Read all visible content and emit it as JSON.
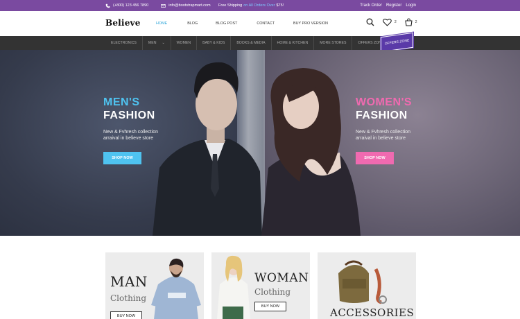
{
  "topbar": {
    "phone": "(+800) 123 456 7890",
    "email": "info@bootstrapmart.com",
    "shipping_prefix": "Free Shipping",
    "shipping_highlight": "on All Orders Over",
    "shipping_amount": "$75!",
    "links": [
      "Track Order",
      "Register",
      "Login"
    ]
  },
  "header": {
    "logo": "Believe",
    "nav": [
      "HOME",
      "BLOG",
      "BLOG POST",
      "CONTACT",
      "BUY PRO VERSION"
    ],
    "wishlist_count": "2",
    "cart_count": "2"
  },
  "categories": [
    "ELECTRONICS",
    "MEN",
    "WOMEN",
    "BABY & KIDS",
    "BOOKS & MEDIA",
    "HOME & KITCHEN",
    "MORE STORES",
    "OFFERS ZONE"
  ],
  "offers_badge": "OFFERS ZONE",
  "hero": {
    "men": {
      "line1": "MEN'S",
      "line2": "FASHION",
      "subtitle": "New & Fvhresh collection arraival in believe store",
      "button": "SHOP NOW"
    },
    "women": {
      "line1": "WOMEN'S",
      "line2": "FASHION",
      "subtitle": "New & Fvhresh collection arraival in believe store",
      "button": "SHOP NOW"
    }
  },
  "cards": {
    "man": {
      "title": "MAN",
      "subtitle": "Clothing",
      "button": "BUY NOW"
    },
    "woman": {
      "title": "WOMAN",
      "subtitle": "Clothing",
      "button": "BUY NOW"
    },
    "accessories": {
      "title": "ACCESSORIES"
    }
  },
  "colors": {
    "topbar": "#7a4aa0",
    "accent_blue": "#4fc3f0",
    "accent_pink": "#f06ab0",
    "catnav": "#333333",
    "offers_badge": "#5a3aa8"
  },
  "icons": {
    "phone": "phone-icon",
    "email": "email-icon",
    "search": "search-icon",
    "wishlist": "heart-icon",
    "cart": "cart-icon"
  }
}
